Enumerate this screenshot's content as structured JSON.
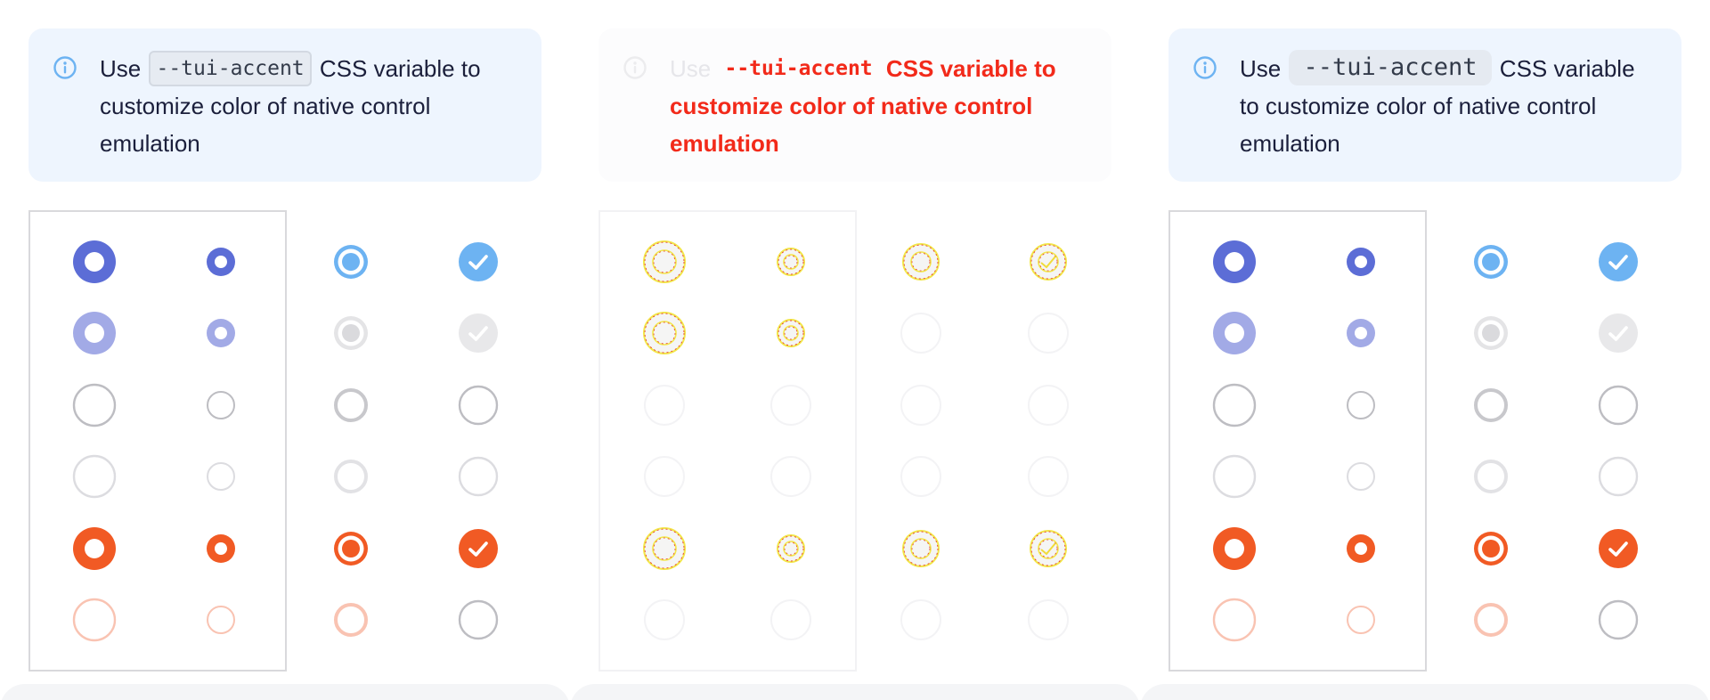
{
  "notice": {
    "prefix": "Use",
    "code": "--tui-accent",
    "suffix": "CSS variable to customize color of native control emulation"
  },
  "ghost_notice": {
    "prefix": "Use",
    "code": "--tui-accent",
    "suffix": "CSS variable to customize color of native control emulation"
  },
  "colors": {
    "primary": "#5c6dd6",
    "primary_light": "#a2aae6",
    "link": "#6db3f2",
    "neutral": "#c8c8cc",
    "neutral_fill": "#e8e8ea",
    "outline_dark": "#bdbdc2",
    "outline_light": "#dcdce0",
    "danger": "#f15a24",
    "danger_light": "#f9c3b2",
    "notice_bg": "#eef5fe",
    "info": "#6db3f2"
  },
  "controls": {
    "rows": [
      "checked",
      "checked-disabled",
      "unchecked",
      "unchecked-disabled",
      "invalid-checked",
      "invalid-disabled"
    ],
    "columns": [
      "radio-large",
      "radio-small",
      "radio-native",
      "checkbox-native"
    ]
  }
}
